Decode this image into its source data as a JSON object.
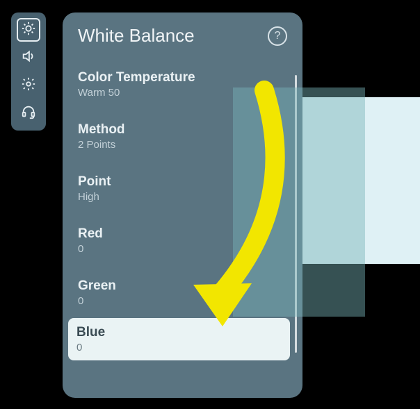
{
  "panel": {
    "title": "White Balance"
  },
  "settings": {
    "color_temp": {
      "label": "Color Temperature",
      "value": "Warm 50"
    },
    "method": {
      "label": "Method",
      "value": "2 Points"
    },
    "point": {
      "label": "Point",
      "value": "High"
    },
    "red": {
      "label": "Red",
      "value": "0"
    },
    "green": {
      "label": "Green",
      "value": "0"
    },
    "blue": {
      "label": "Blue",
      "value": "0"
    }
  },
  "help": {
    "glyph": "?"
  }
}
